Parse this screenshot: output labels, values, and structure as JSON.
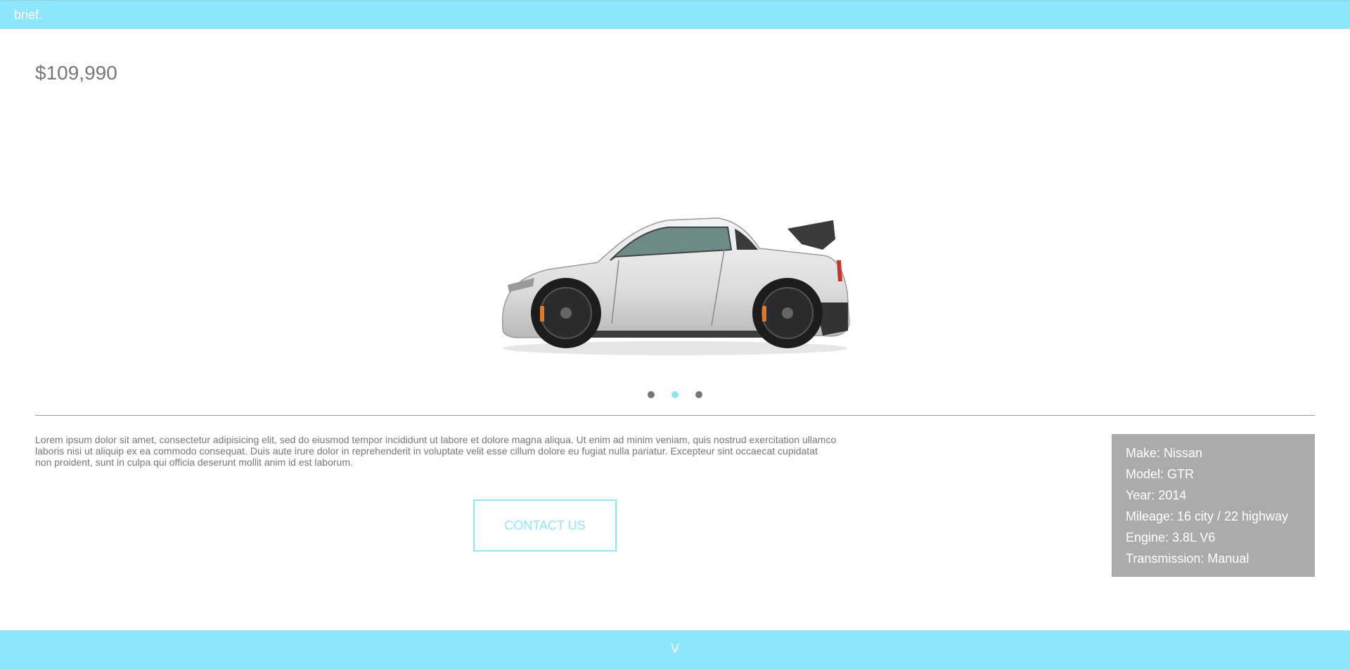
{
  "header": {
    "brand": "brief."
  },
  "listing": {
    "price": "$109,990"
  },
  "carousel": {
    "image_alt": "silver-sports-coupe",
    "dots": 3,
    "active_index": 1
  },
  "description": "Lorem ipsum dolor sit amet, consectetur adipisicing elit, sed do eiusmod tempor incididunt ut labore et dolore magna aliqua. Ut enim ad minim veniam, quis nostrud exercitation ullamco laboris nisi ut aliquip ex ea commodo consequat. Duis aute irure dolor in reprehenderit in voluptate velit esse cillum dolore eu fugiat nulla pariatur. Excepteur sint occaecat cupidatat non proident, sunt in culpa qui officia deserunt mollit anim id est laborum.",
  "cta": {
    "label": "CONTACT US"
  },
  "specs": [
    "Make: Nissan",
    "Model: GTR",
    "Year: 2014",
    "Mileage: 16 city / 22 highway",
    "Engine: 3.8L V6",
    "Transmission: Manual"
  ],
  "footer": {
    "scroll_label": "V"
  },
  "colors": {
    "accent": "#8ee6fd",
    "panel": "#ababab",
    "text": "#777777"
  }
}
